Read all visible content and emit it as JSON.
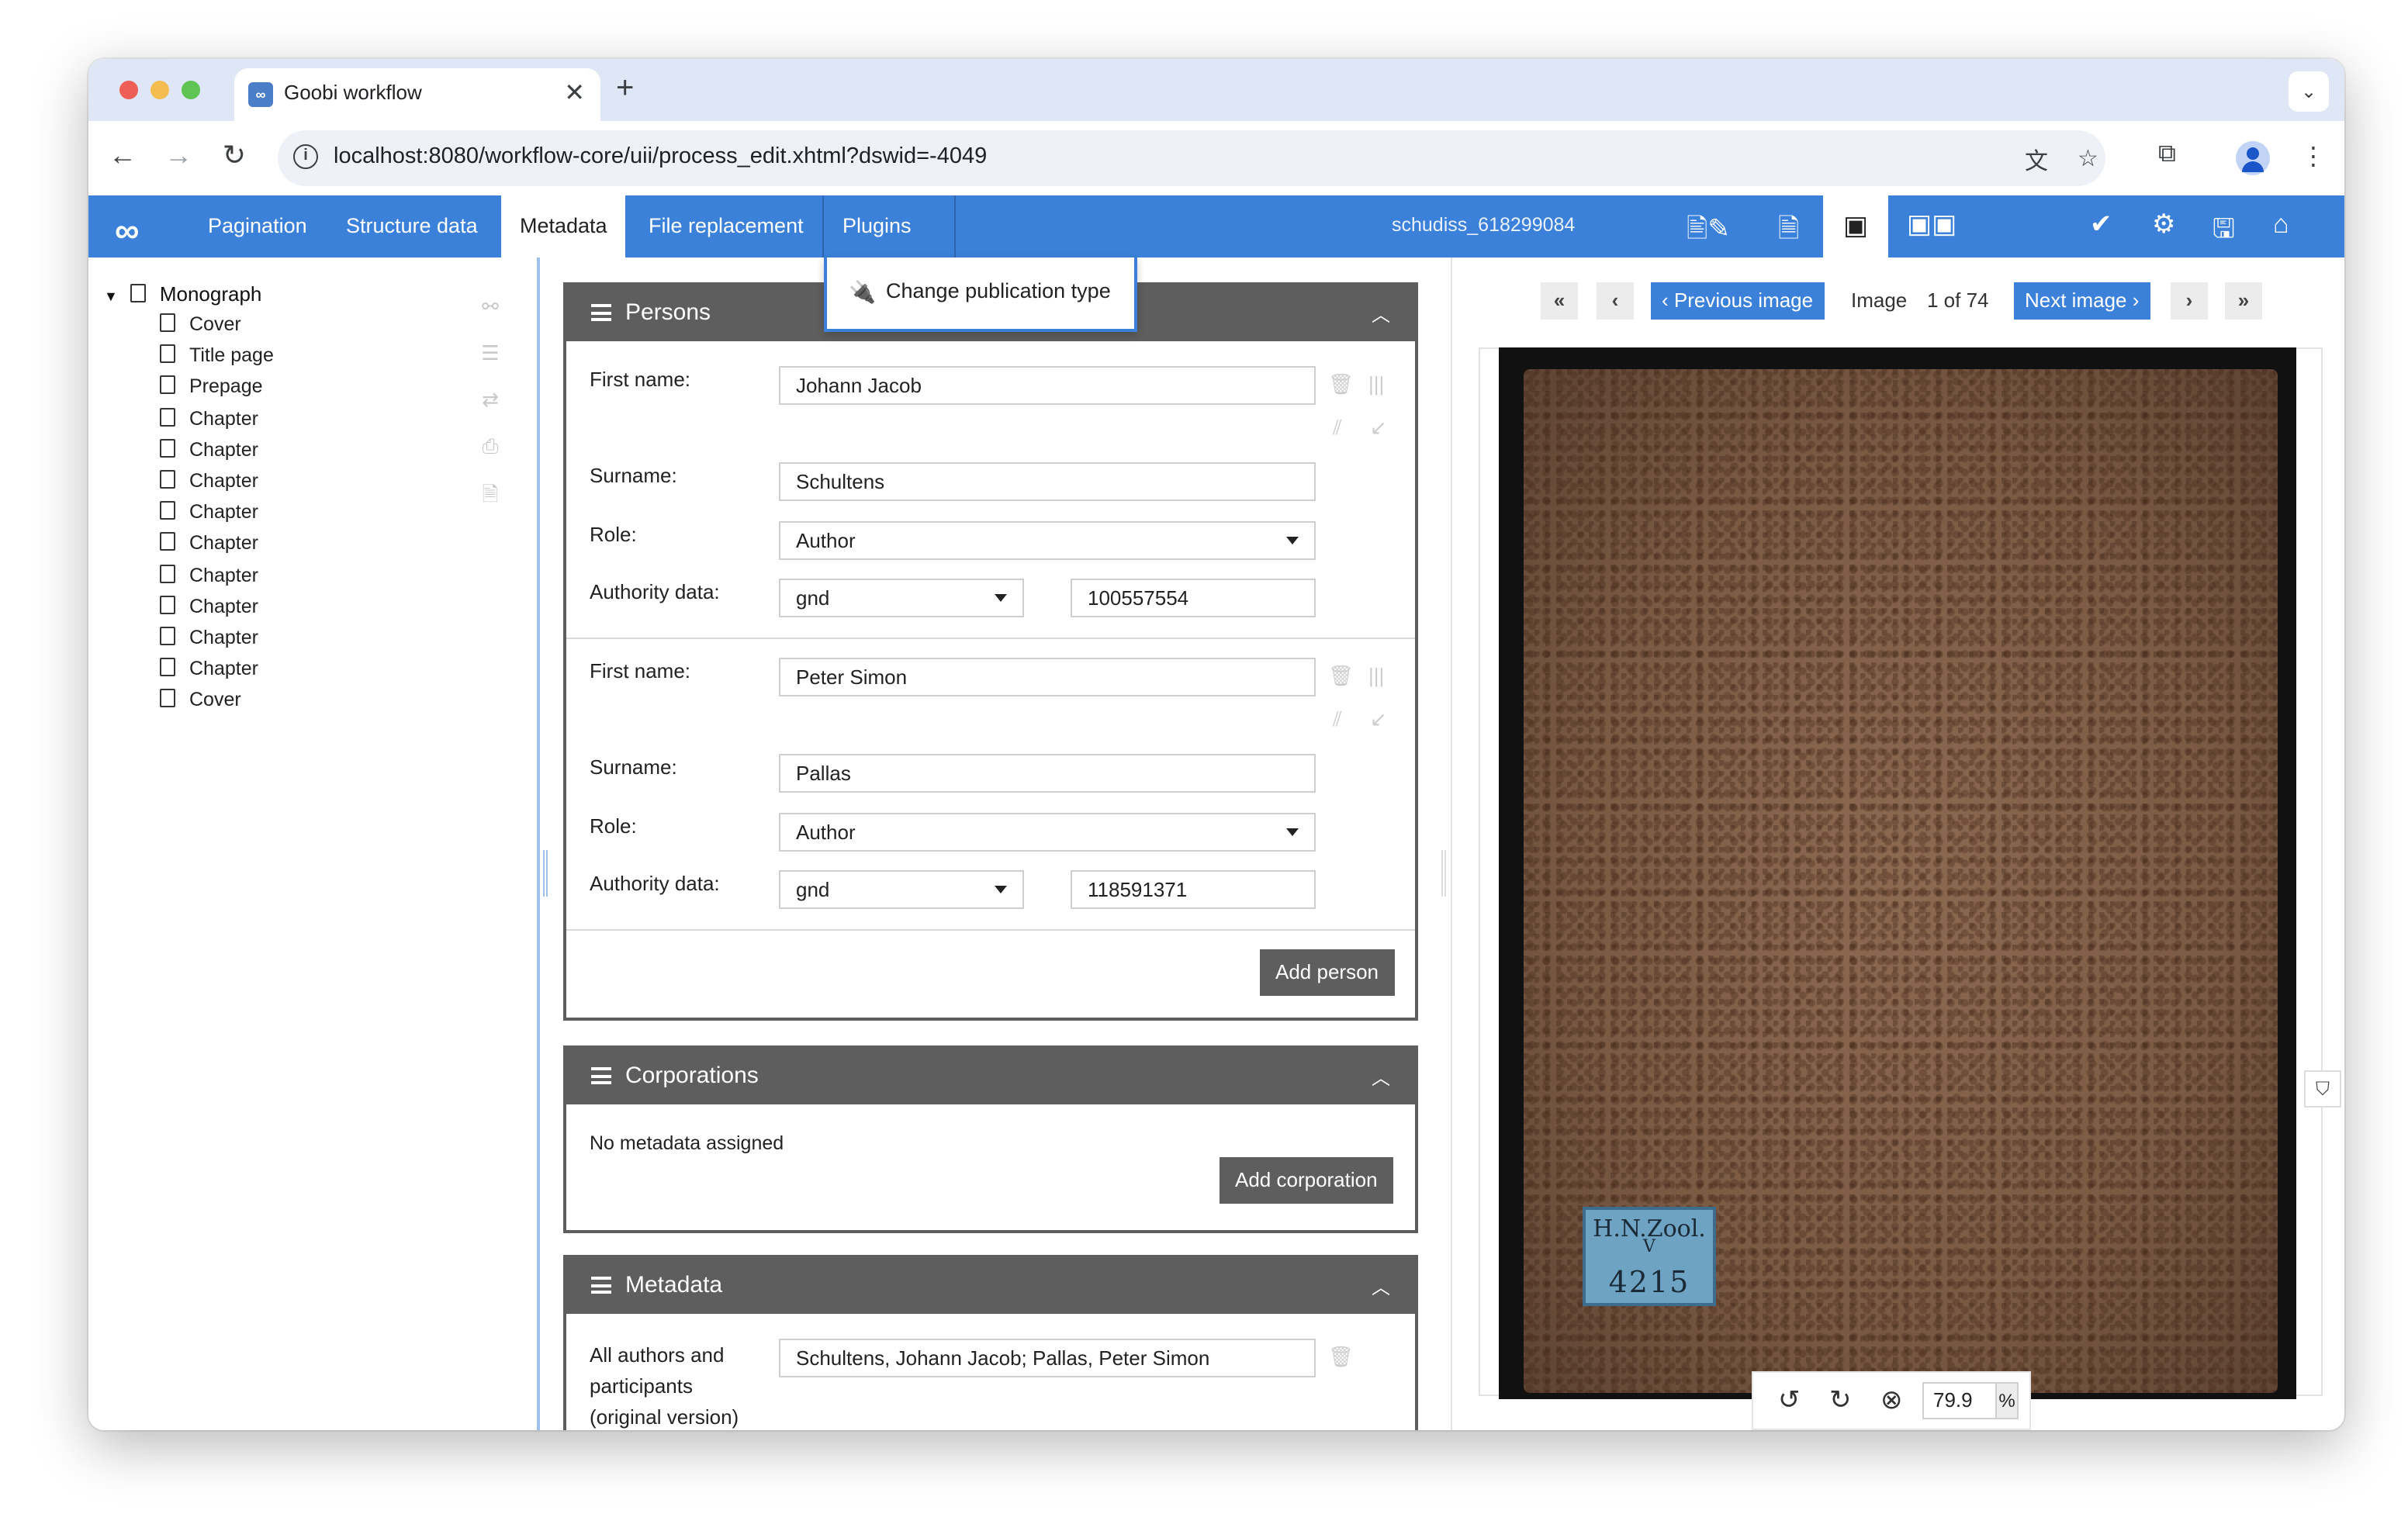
{
  "browser": {
    "tab_title": "Goobi workflow",
    "tab_favicon": "goobi-logo-icon",
    "url": "localhost:8080/workflow-core/uii/process_edit.xhtml?dswid=-4049",
    "colors": {
      "tabstrip": "#dfe6f5",
      "omnibox": "#eef1f8"
    }
  },
  "appbar": {
    "logo": "∞",
    "nav": {
      "pagination": "Pagination",
      "structure": "Structure data",
      "metadata": "Metadata",
      "file_replacement": "File replacement",
      "plugins": "Plugins"
    },
    "process_id": "schudiss_618299084",
    "icons": [
      "edit-document-icon",
      "document-icon",
      "image-icon",
      "dual-image-icon",
      "check-icon",
      "gear-icon",
      "save-icon",
      "home-icon"
    ],
    "accent_color": "#3b80d9"
  },
  "plugins_menu": {
    "items": [
      {
        "label": "Change publication type",
        "icon": "plug-icon"
      }
    ]
  },
  "tree": {
    "root": "Monograph",
    "items": [
      "Cover",
      "Title page",
      "Prepage",
      "Chapter",
      "Chapter",
      "Chapter",
      "Chapter",
      "Chapter",
      "Chapter",
      "Chapter",
      "Chapter",
      "Chapter",
      "Cover"
    ]
  },
  "persons": {
    "title": "Persons",
    "labels": {
      "first_name": "First name:",
      "surname": "Surname:",
      "role": "Role:",
      "authority": "Authority data:"
    },
    "entries": [
      {
        "first_name": "Johann Jacob",
        "surname": "Schultens",
        "role": "Author",
        "authority_source": "gnd",
        "authority_id": "100557554"
      },
      {
        "first_name": "Peter Simon",
        "surname": "Pallas",
        "role": "Author",
        "authority_source": "gnd",
        "authority_id": "118591371"
      }
    ],
    "add_button": "Add person"
  },
  "corporations": {
    "title": "Corporations",
    "empty_text": "No metadata assigned",
    "add_button": "Add corporation"
  },
  "metadata": {
    "title": "Metadata",
    "field_label": "All authors and participants (original version)",
    "field_value": "Schultens, Johann Jacob; Pallas, Peter Simon"
  },
  "image_viewer": {
    "previous": "Previous image",
    "next": "Next image",
    "image_label": "Image",
    "counter": "1 of 74",
    "zoom_value": "79.9",
    "zoom_unit": "%",
    "sticker": {
      "line1": "H.N.Zool.",
      "line2": "V",
      "line3": "4215"
    }
  }
}
